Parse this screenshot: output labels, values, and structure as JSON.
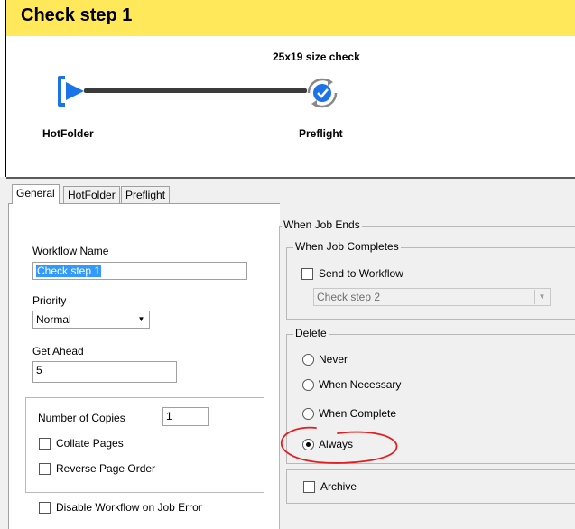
{
  "title": "Check step 1",
  "workflow": {
    "step_title": "25x19 size check",
    "nodes": [
      {
        "label": "HotFolder",
        "icon": "hotfolder-play-icon"
      },
      {
        "label": "Preflight",
        "icon": "preflight-check-icon"
      }
    ]
  },
  "tabs": [
    {
      "label": "General",
      "active": true
    },
    {
      "label": "HotFolder",
      "active": false
    },
    {
      "label": "Preflight",
      "active": false
    }
  ],
  "general": {
    "workflow_name_label": "Workflow Name",
    "workflow_name_value": "Check step 1",
    "priority_label": "Priority",
    "priority_value": "Normal",
    "get_ahead_label": "Get Ahead",
    "get_ahead_value": "5",
    "copies_label": "Number of Copies",
    "copies_value": "1",
    "collate_label": "Collate Pages",
    "reverse_label": "Reverse Page Order",
    "disable_label": "Disable Workflow on Job Error"
  },
  "job_ends": {
    "group_label": "When Job Ends",
    "completes_label": "When Job Completes",
    "send_label": "Send to Workflow",
    "send_target": "Check step 2",
    "delete_label": "Delete",
    "delete_options": [
      "Never",
      "When Necessary",
      "When Complete",
      "Always"
    ],
    "delete_selected": "Always",
    "archive_label": "Archive"
  },
  "colors": {
    "title_bar": "#ffe85a",
    "icon_blue": "#1a73e8",
    "annotation": "#e02020"
  }
}
